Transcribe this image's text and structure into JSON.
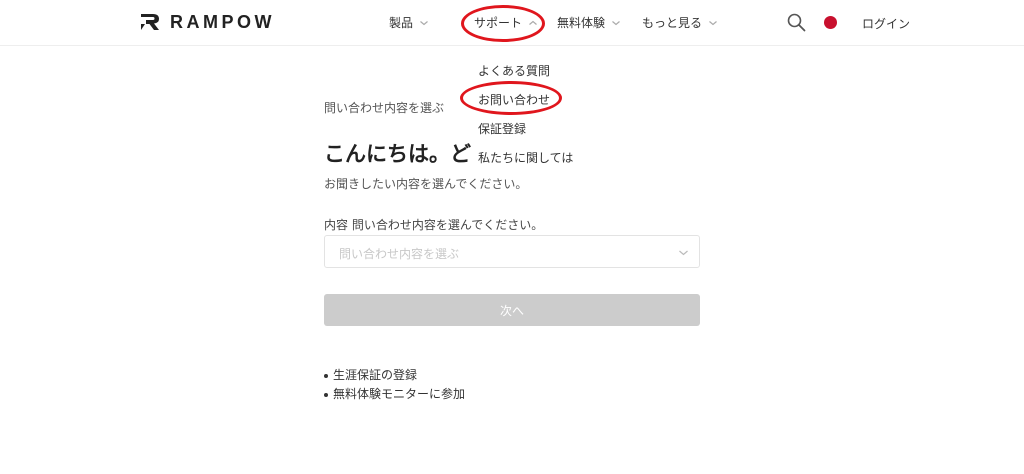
{
  "header": {
    "logo_text": "RAMPOW",
    "nav": {
      "products": "製品",
      "support": "サポート",
      "trial": "無料体験",
      "more": "もっと見る"
    },
    "login": "ログイン"
  },
  "support_menu": {
    "items": [
      "よくある質問",
      "お問い合わせ",
      "保証登録",
      "私たちに関しては"
    ]
  },
  "main": {
    "breadcrumb": "問い合わせ内容を選ぶ",
    "greeting": "こんにちは。ど",
    "subtitle": "お聞きしたい内容を選んでください。",
    "field_label": "内容 問い合わせ内容を選んでください。",
    "select_placeholder": "問い合わせ内容を選ぶ",
    "next_button": "次へ",
    "links": [
      "生涯保証の登録",
      "無料体験モニターに参加"
    ]
  },
  "colors": {
    "highlight": "#e0161d",
    "disabled_button": "#cccccc",
    "flag": "#c8102e"
  },
  "icons": {
    "search": "search-icon",
    "flag": "japan-flag-icon",
    "chevron": "chevron-down-icon"
  }
}
